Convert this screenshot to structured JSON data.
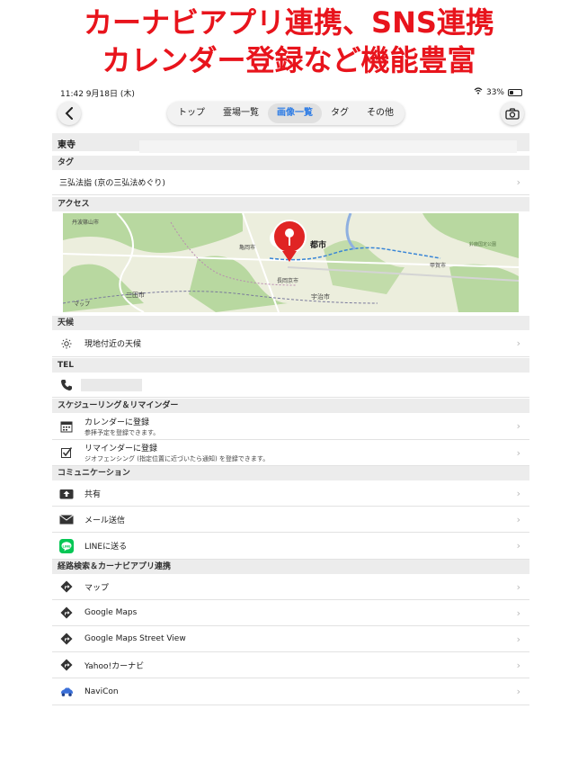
{
  "banner": {
    "line1": "カーナビアプリ連携、SNS連携",
    "line2": "カレンダー登録など機能豊富"
  },
  "status": {
    "time": "11:42 9月18日 (木)",
    "battery": "33%"
  },
  "nav": {
    "back_icon": "chevron-left-icon",
    "camera_icon": "camera-icon",
    "tabs": [
      {
        "label": "トップ",
        "active": false
      },
      {
        "label": "霊場一覧",
        "active": false
      },
      {
        "label": "画像一覧",
        "active": true
      },
      {
        "label": "タグ",
        "active": false
      },
      {
        "label": "その他",
        "active": false
      }
    ]
  },
  "title": "東寺",
  "tag_section": {
    "header": "タグ",
    "value": "三弘法詣 (京の三弘法めぐり)"
  },
  "access": {
    "header": "アクセス",
    "map_labels": [
      "丹波篠山市",
      "亀岡市",
      "都市",
      "長岡京市",
      "三田市",
      "宇治市",
      "甲賀市",
      "鈴鹿国定公園",
      "マップ"
    ]
  },
  "weather": {
    "header": "天候",
    "row_label": "現地付近の天候"
  },
  "tel": {
    "header": "TEL"
  },
  "schedule": {
    "header": "スケジューリング＆リマインダー",
    "rows": [
      {
        "title": "カレンダーに登録",
        "sub": "参拝予定を登録できます。"
      },
      {
        "title": "リマインダーに登録",
        "sub": "ジオフェンシング (指定位置に近づいたら通知) を登録できます。"
      }
    ]
  },
  "communication": {
    "header": "コミュニケーション",
    "rows": [
      {
        "title": "共有"
      },
      {
        "title": "メール送信"
      },
      {
        "title": "LINEに送る"
      }
    ]
  },
  "route": {
    "header": "経路検索＆カーナビアプリ連携",
    "rows": [
      {
        "title": "マップ"
      },
      {
        "title": "Google Maps"
      },
      {
        "title": "Google Maps Street View"
      },
      {
        "title": "Yahoo!カーナビ"
      },
      {
        "title": "NaviCon"
      }
    ]
  },
  "colors": {
    "banner_red": "#e8141c",
    "accent_blue": "#2c7be5",
    "line_green": "#06c755",
    "pin_red": "#e02424"
  }
}
